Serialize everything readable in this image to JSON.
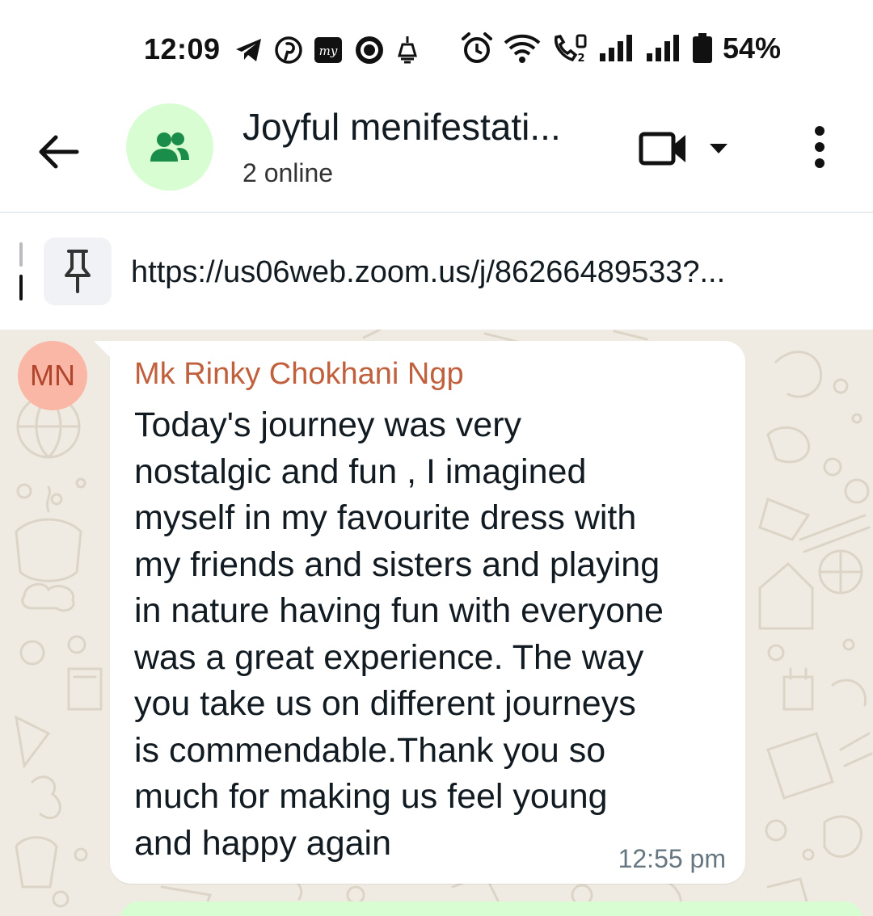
{
  "status_bar": {
    "time": "12:09",
    "battery": "54%",
    "icons_left": [
      "telegram-icon",
      "pinterest-icon",
      "mygov-icon",
      "circle-app-icon",
      "lamp-icon"
    ],
    "icons_right": [
      "alarm-icon",
      "wifi-icon",
      "wifi-call-icon",
      "signal-sim1-icon",
      "signal-sim2-icon",
      "battery-icon"
    ]
  },
  "header": {
    "title": "Joyful menifestati...",
    "subtitle": "2 online",
    "avatar_icon": "group-icon",
    "avatar_color": "#d9fdd3",
    "icon_color": "#1a8d4a"
  },
  "pinned": {
    "text": "https://us06web.zoom.us/j/86266489533?..."
  },
  "messages": [
    {
      "avatar_initials": "MN",
      "avatar_color": "#fbb7a6",
      "sender": "Mk Rinky Chokhani Ngp",
      "sender_color": "#c0603d",
      "text": "Today's journey was very\nnostalgic and fun , I imagined\nmyself in my favourite dress with\nmy friends and sisters and playing\nin nature having fun with everyone\nwas a great experience. The way\nyou take us on different journeys\nis commendable.Thank you so\nmuch for making us feel young\nand happy again",
      "time": "12:55 pm"
    }
  ],
  "colors": {
    "chat_background": "#efeae2",
    "outgoing_bubble": "#d9fdd3",
    "incoming_bubble": "#ffffff"
  }
}
